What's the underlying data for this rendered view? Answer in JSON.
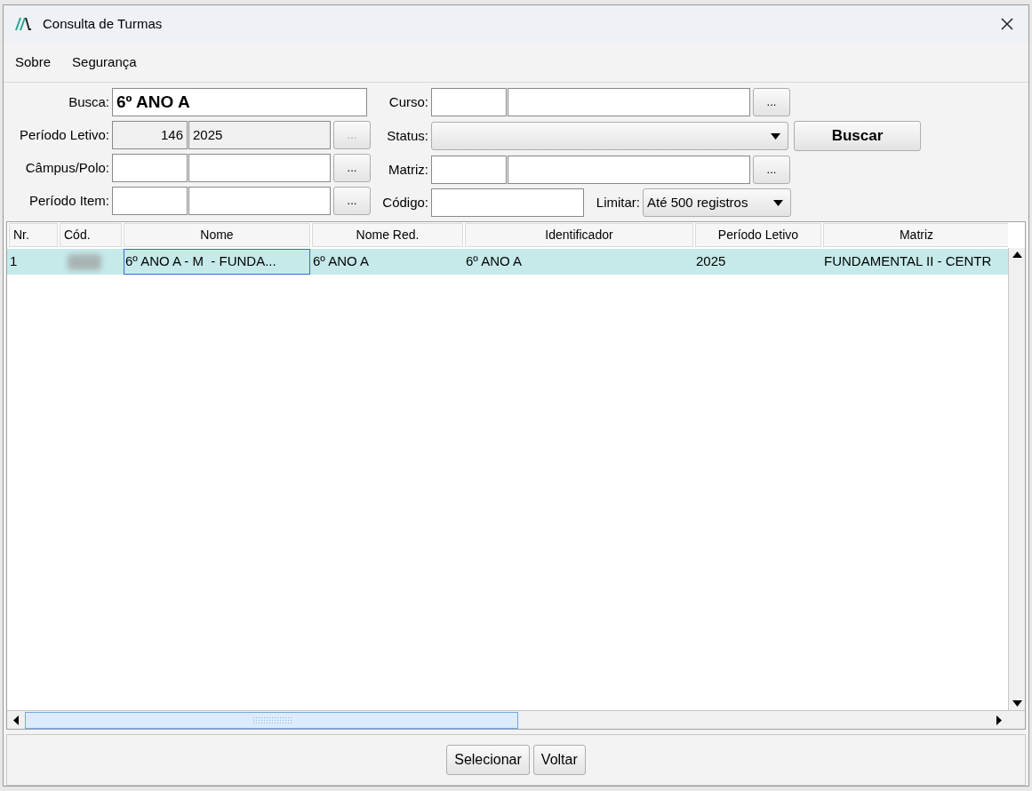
{
  "window": {
    "title": "Consulta de Turmas"
  },
  "menu": [
    "Sobre",
    "Segurança"
  ],
  "form": {
    "busca": {
      "label": "Busca:",
      "value": "6º ANO A"
    },
    "periodo_letivo": {
      "label": "Período Letivo:",
      "code": "146",
      "name": "2025",
      "disabled": true,
      "button": "..."
    },
    "campus": {
      "label": "Câmpus/Polo:",
      "button": "..."
    },
    "periodo_item": {
      "label": "Período Item:",
      "button": "..."
    },
    "curso": {
      "label": "Curso:",
      "button": "..."
    },
    "status": {
      "label": "Status:"
    },
    "matriz": {
      "label": "Matriz:",
      "button": "..."
    },
    "codigo": {
      "label": "Código:"
    },
    "limitar": {
      "label": "Limitar:",
      "value": "Até 500 registros"
    },
    "search_button": "Buscar"
  },
  "table": {
    "columns": [
      "Nr.",
      "Cód.",
      "Nome",
      "Nome Red.",
      "Identificador",
      "Período Letivo",
      "Matriz"
    ],
    "rows": [
      {
        "selected": true,
        "cells": [
          "1",
          "",
          "6º ANO A - M  - FUNDA...",
          "6º ANO A",
          "6º ANO A",
          "2025",
          "FUNDAMENTAL II - CENTR"
        ]
      }
    ]
  },
  "buttons": [
    "Selecionar",
    "Voltar"
  ]
}
